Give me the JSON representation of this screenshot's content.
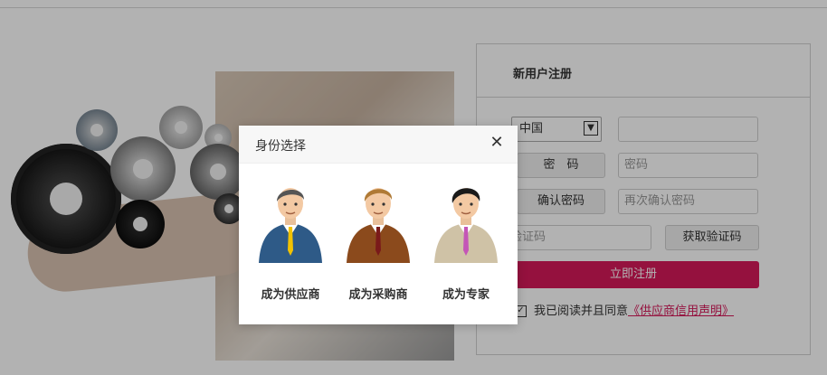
{
  "register": {
    "title": "新用户注册",
    "country_select": {
      "value": "中国"
    },
    "phone_input": {
      "placeholder": ""
    },
    "password_label": "密　码",
    "password_input": {
      "placeholder": "密码"
    },
    "confirm_label": "确认密码",
    "confirm_input": {
      "placeholder": "再次确认密码"
    },
    "code_input": {
      "placeholder": "验证码"
    },
    "get_code_label": "获取验证码",
    "submit_label": "立即注册",
    "agree_text": "我已阅读并且同意",
    "agree_link": "《供应商信用声明》"
  },
  "modal": {
    "title": "身份选择",
    "close_icon": "close-icon",
    "roles": [
      {
        "label": "成为供应商",
        "icon": "supplier-avatar-icon",
        "suit_color": "#2e5a87",
        "tie_color": "#f2c200",
        "hair_color": "#555555"
      },
      {
        "label": "成为采购商",
        "icon": "buyer-avatar-icon",
        "suit_color": "#8b4a1c",
        "tie_color": "#7a1a1a",
        "hair_color": "#b07a35"
      },
      {
        "label": "成为专家",
        "icon": "expert-avatar-icon",
        "suit_color": "#cfc2a6",
        "tie_color": "#c455b7",
        "hair_color": "#1a1a1a"
      }
    ]
  },
  "colors": {
    "accent": "#d6195a",
    "overlay": "rgba(0,0,0,0.3)"
  }
}
